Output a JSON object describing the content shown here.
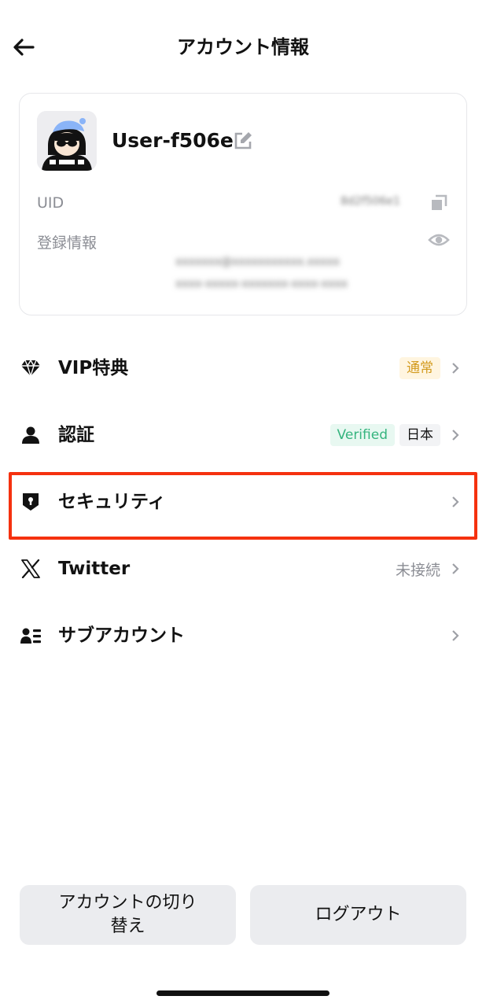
{
  "header": {
    "title": "アカウント情報",
    "back_icon": "arrow-left-icon"
  },
  "profile": {
    "username": "User-f506e",
    "uid_label": "UID",
    "uid_value": "8d2f506e1",
    "registration_label": "登録情報",
    "registration_value_line1": "xxxxxxx@xxxxxxxxxxx.xxxxx",
    "registration_value_line2": "xxxx-xxxxx-xxxxxxx-xxxx-xxxx"
  },
  "menu": {
    "items": [
      {
        "label": "VIP特典",
        "icon": "diamond-icon",
        "badge": "通常"
      },
      {
        "label": "認証",
        "icon": "person-icon",
        "badge": "Verified",
        "region": "日本"
      },
      {
        "label": "セキュリティ",
        "icon": "shield-lock-icon"
      },
      {
        "label": "Twitter",
        "icon": "x-logo-icon",
        "status": "未接続"
      },
      {
        "label": "サブアカウント",
        "icon": "sub-account-icon"
      }
    ]
  },
  "actions": {
    "switch_account": "アカウントの切り替え",
    "logout": "ログアウト"
  },
  "colors": {
    "highlight": "#f5310f",
    "vip_badge": "#d39b1e",
    "verified_badge": "#35b47e",
    "muted_text": "#8b8d94"
  }
}
